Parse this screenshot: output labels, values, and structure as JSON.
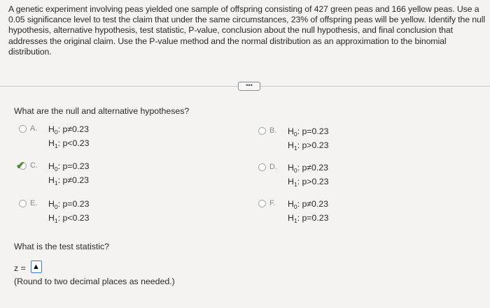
{
  "problem": {
    "text": "A genetic experiment involving peas yielded one sample of offspring consisting of 427 green peas and 166 yellow peas. Use a 0.05 significance level to test the claim that under the same circumstances, 23% of offspring peas will be yellow. Identify the null hypothesis, alternative hypothesis, test statistic, P-value, conclusion about the null hypothesis, and final conclusion that addresses the original claim. Use the P-value method and the normal distribution as an approximation to the binomial distribution."
  },
  "more_button": {
    "label": "•••"
  },
  "question1": {
    "text": "What are the null and alternative hypotheses?",
    "options": [
      {
        "letter": "A.",
        "h0_label": "H",
        "h0_sub": "0",
        "h0_rest": ": p≠0.23",
        "h1_label": "H",
        "h1_sub": "1",
        "h1_rest": ": p<0.23",
        "selected": false
      },
      {
        "letter": "B.",
        "h0_label": "H",
        "h0_sub": "0",
        "h0_rest": ": p=0.23",
        "h1_label": "H",
        "h1_sub": "1",
        "h1_rest": ": p>0.23",
        "selected": false
      },
      {
        "letter": "C.",
        "h0_label": "H",
        "h0_sub": "0",
        "h0_rest": ": p=0.23",
        "h1_label": "H",
        "h1_sub": "1",
        "h1_rest": ": p≠0.23",
        "selected": true
      },
      {
        "letter": "D.",
        "h0_label": "H",
        "h0_sub": "0",
        "h0_rest": ": p≠0.23",
        "h1_label": "H",
        "h1_sub": "1",
        "h1_rest": ": p>0.23",
        "selected": false
      },
      {
        "letter": "E.",
        "h0_label": "H",
        "h0_sub": "0",
        "h0_rest": ": p=0.23",
        "h1_label": "H",
        "h1_sub": "1",
        "h1_rest": ": p<0.23",
        "selected": false
      },
      {
        "letter": "F.",
        "h0_label": "H",
        "h0_sub": "0",
        "h0_rest": ": p≠0.23",
        "h1_label": "H",
        "h1_sub": "1",
        "h1_rest": ": p=0.23",
        "selected": false
      }
    ]
  },
  "question2": {
    "text": "What is the test statistic?",
    "answer_prefix": "z =",
    "answer_value": "",
    "note": "(Round to two decimal places as needed.)"
  },
  "colors": {
    "check": "#4f8a2c",
    "input_border": "#3a7bd5"
  }
}
